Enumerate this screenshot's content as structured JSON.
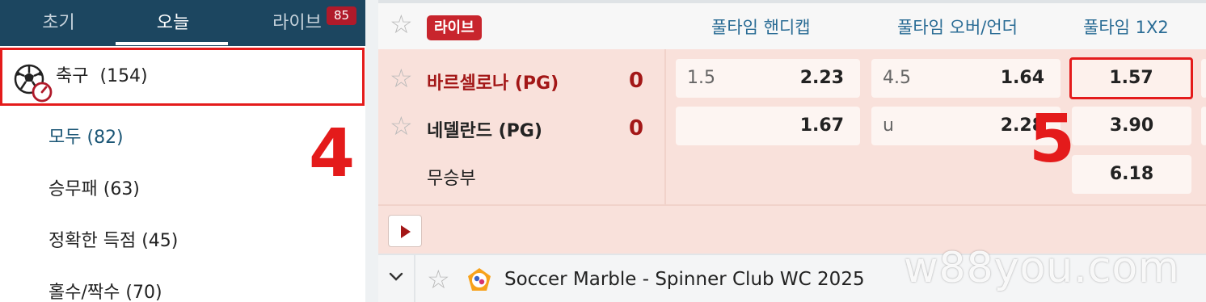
{
  "sidebar": {
    "tabs": [
      {
        "label": "초기"
      },
      {
        "label": "오늘"
      },
      {
        "label": "라이브",
        "badge": "85"
      }
    ],
    "active_tab": "오늘",
    "sport": {
      "label": "축구",
      "count": "(154)",
      "icon": "soccer-ball-timer-icon"
    },
    "sub_items": [
      {
        "label": "모두",
        "count": "(82)"
      },
      {
        "label": "승무패",
        "count": "(63)"
      },
      {
        "label": "정확한 득점",
        "count": "(45)"
      },
      {
        "label": "홀수/짝수",
        "count": "(70)"
      }
    ]
  },
  "board": {
    "live_badge": "라이브",
    "columns": [
      "풀타임 핸디캡",
      "풀타임 오버/언더",
      "풀타임 1X2"
    ],
    "match": {
      "home": {
        "name": "바르셀로나 (PG)",
        "score": "0"
      },
      "away": {
        "name": "네델란드 (PG)",
        "score": "0"
      },
      "draw_label": "무승부",
      "handicap": [
        {
          "line": "1.5",
          "odds": "2.23"
        },
        {
          "line": "",
          "odds": "1.67"
        }
      ],
      "over_under": [
        {
          "line": "4.5",
          "odds": "1.64"
        },
        {
          "line": "u",
          "odds": "2.28"
        }
      ],
      "one_x_two": [
        "1.57",
        "3.90",
        "6.18"
      ]
    },
    "next_event": {
      "title": "Soccer Marble - Spinner Club WC 2025"
    }
  },
  "annotations": {
    "marker_4": "4",
    "marker_5": "5"
  },
  "watermark": "w88you.com",
  "colors": {
    "header_bg": "#1c4660",
    "live_red": "#c8252d",
    "highlight_red": "#e41b1b",
    "column_head": "#2a6c95",
    "match_bg": "#f9e1db"
  }
}
